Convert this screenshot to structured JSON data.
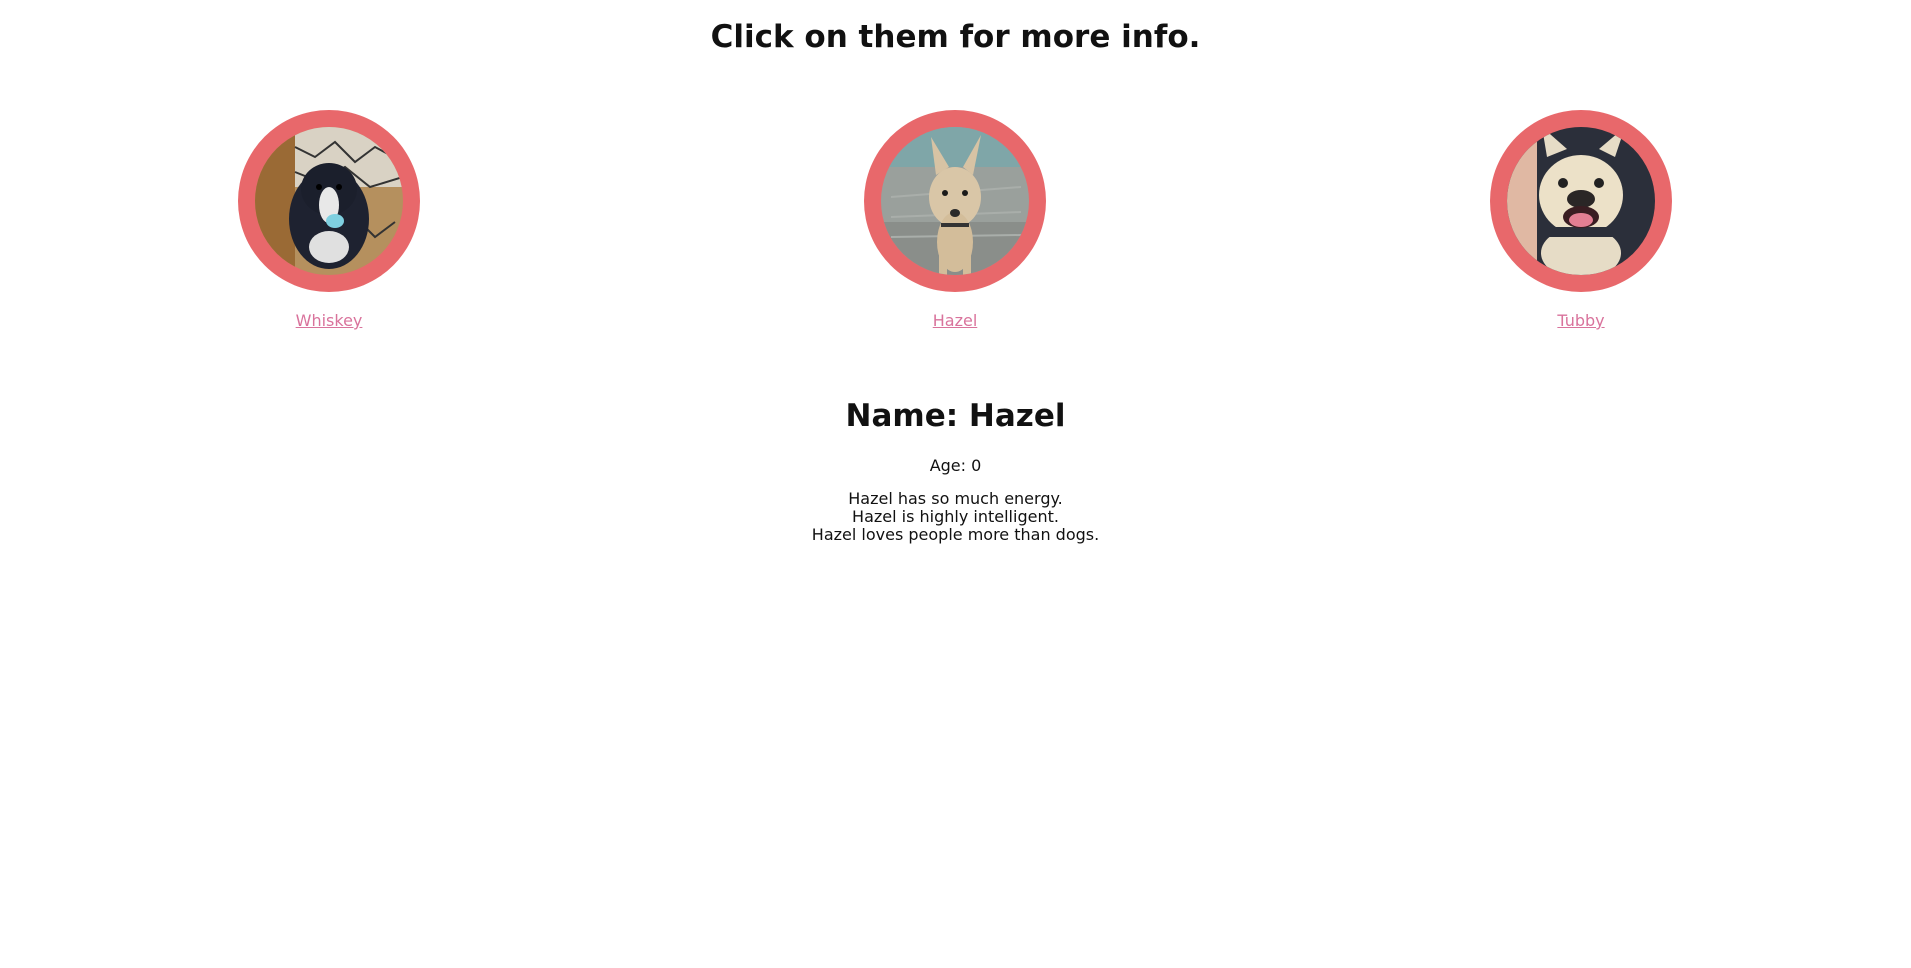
{
  "page": {
    "heading": "Click on them for more info."
  },
  "dogs": [
    {
      "name": "Whiskey",
      "photo_icon": "black-white-puppy-photo"
    },
    {
      "name": "Hazel",
      "photo_icon": "tan-dog-photo"
    },
    {
      "name": "Tubby",
      "photo_icon": "french-bulldog-photo"
    }
  ],
  "details": {
    "name_line": "Name: Hazel",
    "age_line": "Age: 0",
    "facts": [
      "Hazel has so much energy.",
      "Hazel is highly intelligent.",
      "Hazel loves people more than dogs."
    ]
  },
  "colors": {
    "ring": "#e8686b",
    "link": "#d9739c",
    "text": "#111111",
    "background": "#ffffff"
  }
}
